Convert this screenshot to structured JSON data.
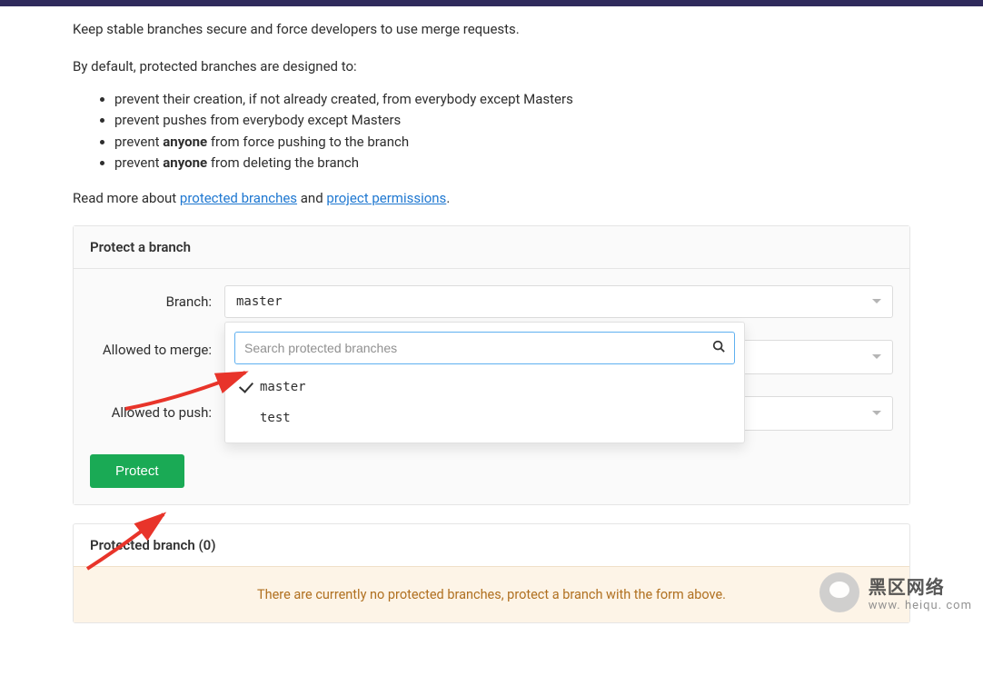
{
  "intro_line": "Keep stable branches secure and force developers to use merge requests.",
  "intro_sub": "By default, protected branches are designed to:",
  "bullets": [
    {
      "pre": "prevent their creation, if not already created, from everybody except Masters",
      "bold": "",
      "post": ""
    },
    {
      "pre": "prevent pushes from everybody except Masters",
      "bold": "",
      "post": ""
    },
    {
      "pre": "prevent ",
      "bold": "anyone",
      "post": " from force pushing to the branch"
    },
    {
      "pre": "prevent ",
      "bold": "anyone",
      "post": " from deleting the branch"
    }
  ],
  "readmore": {
    "pre": "Read more about ",
    "link1": "protected branches",
    "mid": " and ",
    "link2": "project permissions",
    "post": "."
  },
  "panel": {
    "heading": "Protect a branch",
    "labels": {
      "branch": "Branch:",
      "merge": "Allowed to merge:",
      "push": "Allowed to push:"
    },
    "branch_selected": "master",
    "dropdown": {
      "search_placeholder": "Search protected branches",
      "items": [
        {
          "label": "master",
          "selected": true
        },
        {
          "label": "test",
          "selected": false
        }
      ]
    },
    "protect_button": "Protect"
  },
  "protected_list": {
    "heading": "Protected branch (0)",
    "empty_msg": "There are currently no protected branches, protect a branch with the form above."
  },
  "watermark": {
    "line1": "黑区网络",
    "line2": "www. heiqu. com"
  }
}
